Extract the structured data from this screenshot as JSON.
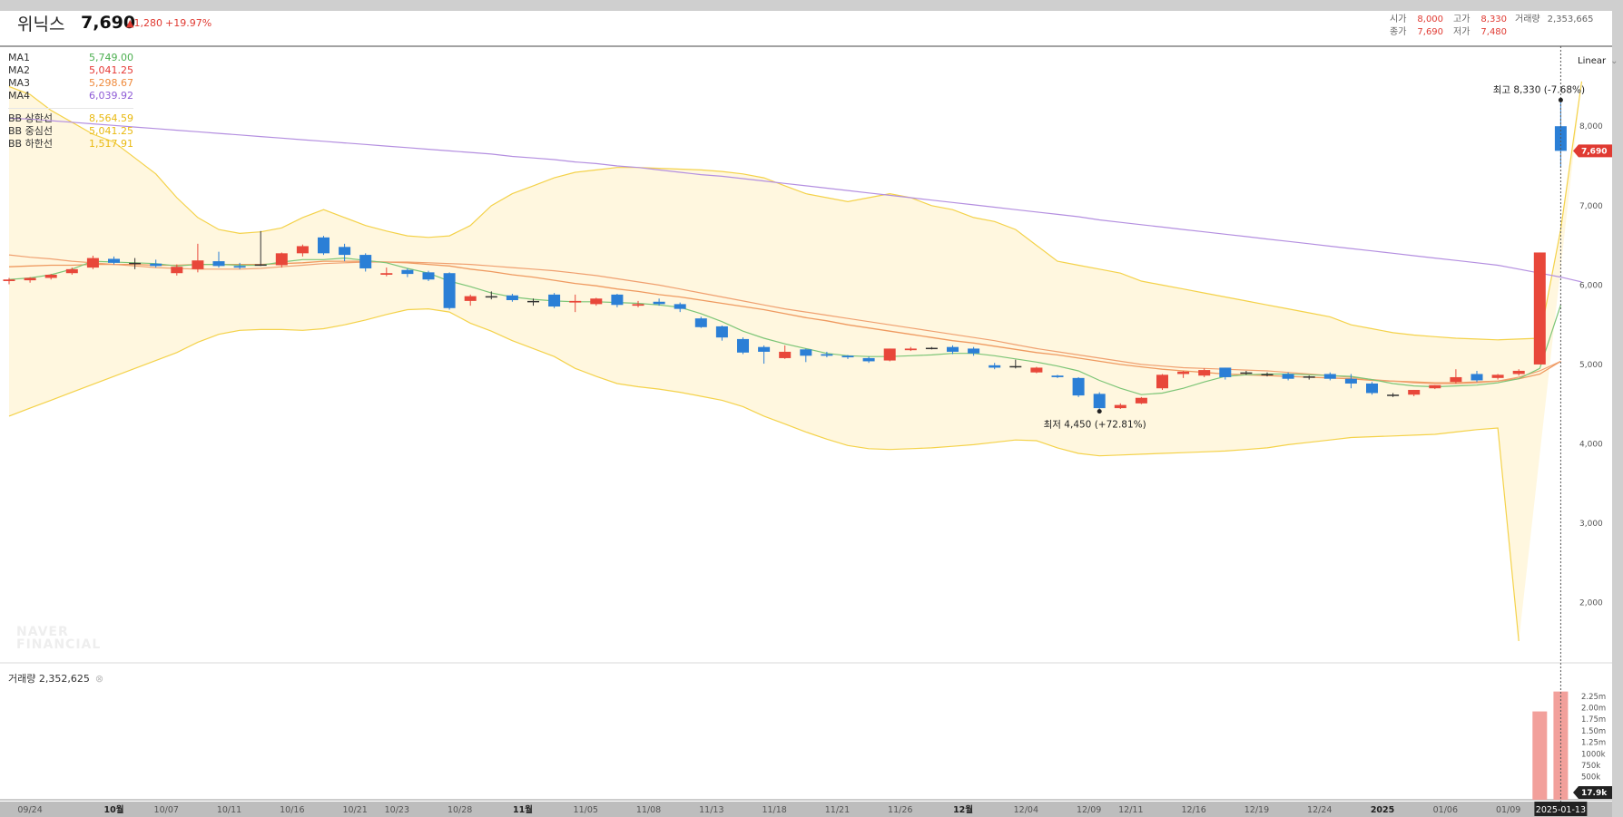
{
  "header": {
    "name": "위닉스",
    "price": "7,690",
    "change": "▲1,280",
    "change_rate": "+19.97%",
    "ohlc": {
      "open_label": "시가",
      "open": "8,000",
      "high_label": "고가",
      "high": "8,330",
      "volume_label": "거래량",
      "volume": "2,353,665",
      "close_label": "종가",
      "close": "7,690",
      "low_label": "저가",
      "low": "7,480"
    }
  },
  "legend": {
    "ma": [
      {
        "name": "MA1",
        "value": "5,749.00",
        "color": "#4caf50"
      },
      {
        "name": "MA2",
        "value": "5,041.25",
        "color": "#e53935"
      },
      {
        "name": "MA3",
        "value": "5,298.67",
        "color": "#ef8a3c"
      },
      {
        "name": "MA4",
        "value": "6,039.92",
        "color": "#8e5bd6"
      }
    ],
    "bb": [
      {
        "name": "BB 상한선",
        "value": "8,564.59",
        "color": "#f2c21b"
      },
      {
        "name": "BB 중심선",
        "value": "5,041.25",
        "color": "#f2c21b"
      },
      {
        "name": "BB 하한선",
        "value": "1,517.91",
        "color": "#f2c21b"
      }
    ]
  },
  "controls": {
    "scale_label": "Linear"
  },
  "watermark": {
    "line1": "NAVER",
    "line2": "FINANCIAL"
  },
  "volume_panel": {
    "label": "거래량 2,352,625",
    "close_icon": "close-icon"
  },
  "annotations": {
    "high": "최고 8,330 (-7.68%)",
    "low": "최저 4,450 (+72.81%)"
  },
  "price_tag": "7,690",
  "volume_tag": "17.9k",
  "crosshair_date": "2025-01-13",
  "colors": {
    "up": "#e8473a",
    "down": "#2b7fd6",
    "band_fill": "#fff7df"
  },
  "chart_data": {
    "type": "candlestick",
    "y_range": [
      1300,
      8950
    ],
    "y_ticks": [
      2000,
      3000,
      4000,
      5000,
      6000,
      7000,
      8000
    ],
    "y_tick_labels": [
      "2,000",
      "3,000",
      "4,000",
      "5,000",
      "6,000",
      "7,000",
      "8,000"
    ],
    "x_ticks": [
      {
        "label": "09/24",
        "i": 1
      },
      {
        "label": "10월",
        "i": 5,
        "bold": true
      },
      {
        "label": "10/07",
        "i": 7.5
      },
      {
        "label": "10/11",
        "i": 10.5
      },
      {
        "label": "10/16",
        "i": 13.5
      },
      {
        "label": "10/21",
        "i": 16.5
      },
      {
        "label": "10/23",
        "i": 18.5
      },
      {
        "label": "10/28",
        "i": 21.5
      },
      {
        "label": "11월",
        "i": 24.5,
        "bold": true
      },
      {
        "label": "11/05",
        "i": 27.5
      },
      {
        "label": "11/08",
        "i": 30.5
      },
      {
        "label": "11/13",
        "i": 33.5
      },
      {
        "label": "11/18",
        "i": 36.5
      },
      {
        "label": "11/21",
        "i": 39.5
      },
      {
        "label": "11/26",
        "i": 42.5
      },
      {
        "label": "12월",
        "i": 45.5,
        "bold": true
      },
      {
        "label": "12/04",
        "i": 48.5
      },
      {
        "label": "12/09",
        "i": 51.5
      },
      {
        "label": "12/11",
        "i": 53.5
      },
      {
        "label": "12/16",
        "i": 56.5
      },
      {
        "label": "12/19",
        "i": 59.5
      },
      {
        "label": "12/24",
        "i": 62.5
      },
      {
        "label": "2025",
        "i": 65.5,
        "bold": true
      },
      {
        "label": "01/06",
        "i": 68.5
      },
      {
        "label": "01/09",
        "i": 71.5
      }
    ],
    "candles": [
      [
        6050,
        6090,
        6010,
        6070
      ],
      [
        6060,
        6100,
        6030,
        6090
      ],
      [
        6090,
        6140,
        6070,
        6130
      ],
      [
        6150,
        6220,
        6130,
        6200
      ],
      [
        6220,
        6370,
        6200,
        6340
      ],
      [
        6330,
        6360,
        6260,
        6280
      ],
      [
        6270,
        6340,
        6200,
        6280
      ],
      [
        6270,
        6320,
        6220,
        6240
      ],
      [
        6150,
        6260,
        6120,
        6230
      ],
      [
        6200,
        6520,
        6160,
        6310
      ],
      [
        6300,
        6420,
        6220,
        6240
      ],
      [
        6240,
        6280,
        6200,
        6220
      ],
      [
        6250,
        6680,
        6240,
        6260
      ],
      [
        6250,
        6410,
        6220,
        6400
      ],
      [
        6400,
        6510,
        6360,
        6490
      ],
      [
        6600,
        6620,
        6380,
        6400
      ],
      [
        6480,
        6520,
        6300,
        6380
      ],
      [
        6380,
        6400,
        6170,
        6210
      ],
      [
        6130,
        6220,
        6110,
        6150
      ],
      [
        6190,
        6210,
        6100,
        6140
      ],
      [
        6160,
        6180,
        6050,
        6070
      ],
      [
        6150,
        6160,
        5690,
        5710
      ],
      [
        5800,
        5880,
        5740,
        5860
      ],
      [
        5860,
        5920,
        5820,
        5860
      ],
      [
        5870,
        5890,
        5790,
        5810
      ],
      [
        5790,
        5830,
        5740,
        5800
      ],
      [
        5880,
        5900,
        5710,
        5730
      ],
      [
        5780,
        5880,
        5660,
        5800
      ],
      [
        5760,
        5840,
        5740,
        5830
      ],
      [
        5880,
        5890,
        5720,
        5750
      ],
      [
        5740,
        5800,
        5720,
        5760
      ],
      [
        5790,
        5830,
        5740,
        5760
      ],
      [
        5760,
        5780,
        5660,
        5700
      ],
      [
        5580,
        5600,
        5460,
        5470
      ],
      [
        5480,
        5490,
        5300,
        5340
      ],
      [
        5320,
        5340,
        5130,
        5150
      ],
      [
        5220,
        5240,
        5010,
        5160
      ],
      [
        5080,
        5240,
        5070,
        5160
      ],
      [
        5190,
        5200,
        5030,
        5110
      ],
      [
        5130,
        5160,
        5090,
        5110
      ],
      [
        5110,
        5120,
        5070,
        5090
      ],
      [
        5080,
        5100,
        5020,
        5040
      ],
      [
        5050,
        5200,
        5040,
        5200
      ],
      [
        5180,
        5220,
        5170,
        5200
      ],
      [
        5210,
        5220,
        5190,
        5200
      ],
      [
        5220,
        5240,
        5130,
        5160
      ],
      [
        5200,
        5220,
        5110,
        5140
      ],
      [
        4990,
        5020,
        4940,
        4960
      ],
      [
        4970,
        5060,
        4950,
        4980
      ],
      [
        4900,
        4970,
        4890,
        4960
      ],
      [
        4860,
        4870,
        4830,
        4840
      ],
      [
        4830,
        4840,
        4590,
        4610
      ],
      [
        4630,
        4650,
        4410,
        4450
      ],
      [
        4450,
        4510,
        4440,
        4490
      ],
      [
        4510,
        4590,
        4500,
        4580
      ],
      [
        4700,
        4880,
        4680,
        4870
      ],
      [
        4880,
        4920,
        4830,
        4910
      ],
      [
        4860,
        4950,
        4840,
        4930
      ],
      [
        4960,
        4960,
        4810,
        4840
      ],
      [
        4900,
        4920,
        4870,
        4890
      ],
      [
        4870,
        4900,
        4850,
        4880
      ],
      [
        4880,
        4900,
        4800,
        4820
      ],
      [
        4840,
        4860,
        4810,
        4850
      ],
      [
        4880,
        4900,
        4800,
        4820
      ],
      [
        4820,
        4880,
        4700,
        4760
      ],
      [
        4760,
        4780,
        4620,
        4640
      ],
      [
        4620,
        4640,
        4590,
        4610
      ],
      [
        4620,
        4680,
        4600,
        4680
      ],
      [
        4700,
        4740,
        4690,
        4740
      ],
      [
        4780,
        4940,
        4760,
        4840
      ],
      [
        4880,
        4920,
        4780,
        4800
      ],
      [
        4830,
        4880,
        4810,
        4870
      ],
      [
        4880,
        4940,
        4860,
        4920
      ],
      [
        5000,
        6410,
        5000,
        6410
      ],
      [
        8000,
        8330,
        7480,
        7690
      ]
    ],
    "ma1": [
      6070,
      6090,
      6130,
      6200,
      6300,
      6290,
      6280,
      6270,
      6240,
      6260,
      6260,
      6250,
      6250,
      6290,
      6320,
      6320,
      6340,
      6310,
      6280,
      6210,
      6150,
      6050,
      5980,
      5900,
      5850,
      5820,
      5800,
      5790,
      5790,
      5780,
      5770,
      5750,
      5720,
      5640,
      5540,
      5420,
      5330,
      5260,
      5200,
      5140,
      5110,
      5100,
      5100,
      5110,
      5120,
      5140,
      5140,
      5110,
      5070,
      5030,
      4980,
      4920,
      4800,
      4700,
      4620,
      4640,
      4700,
      4780,
      4850,
      4870,
      4880,
      4880,
      4870,
      4860,
      4850,
      4810,
      4760,
      4730,
      4720,
      4730,
      4740,
      4770,
      4820,
      4950,
      5749
    ],
    "ma2": [
      null,
      null,
      null,
      null,
      null,
      null,
      null,
      null,
      null,
      null,
      null,
      null,
      null,
      null,
      null,
      null,
      null,
      null,
      null,
      null,
      null,
      null,
      null,
      null,
      null,
      null,
      null,
      null,
      null,
      null,
      null,
      null,
      null,
      null,
      null,
      null,
      null,
      null,
      null,
      null,
      null,
      null,
      null,
      null,
      null,
      null,
      null,
      null,
      null,
      null,
      null,
      null,
      null,
      null,
      null,
      null,
      null,
      null,
      null,
      null,
      null,
      null,
      null,
      null,
      null,
      null,
      null,
      null,
      null,
      null,
      null,
      null,
      null,
      null,
      5041.25
    ],
    "ma3": [
      6380,
      6350,
      6330,
      6300,
      6280,
      6260,
      6240,
      6220,
      6210,
      6200,
      6200,
      6200,
      6210,
      6230,
      6250,
      6270,
      6280,
      6290,
      6290,
      6290,
      6280,
      6270,
      6260,
      6240,
      6220,
      6200,
      6180,
      6150,
      6120,
      6080,
      6040,
      6000,
      5950,
      5900,
      5850,
      5800,
      5750,
      5700,
      5660,
      5620,
      5580,
      5540,
      5500,
      5460,
      5420,
      5380,
      5340,
      5300,
      5250,
      5200,
      5160,
      5120,
      5080,
      5040,
      5000,
      4980,
      4960,
      4950,
      4940,
      4930,
      4920,
      4900,
      4880,
      4860,
      4840,
      4810,
      4790,
      4770,
      4760,
      4760,
      4770,
      4790,
      4840,
      4920,
      5041
    ],
    "ma4": [
      8100,
      8090,
      8070,
      8050,
      8030,
      8010,
      7990,
      7970,
      7950,
      7930,
      7910,
      7890,
      7870,
      7850,
      7830,
      7810,
      7790,
      7770,
      7750,
      7730,
      7710,
      7690,
      7670,
      7650,
      7620,
      7600,
      7580,
      7550,
      7530,
      7500,
      7480,
      7450,
      7420,
      7390,
      7370,
      7340,
      7310,
      7280,
      7250,
      7220,
      7190,
      7160,
      7130,
      7100,
      7070,
      7040,
      7010,
      6980,
      6950,
      6920,
      6890,
      6860,
      6820,
      6790,
      6760,
      6730,
      6700,
      6670,
      6640,
      6610,
      6580,
      6550,
      6520,
      6490,
      6460,
      6430,
      6400,
      6370,
      6340,
      6310,
      6280,
      6250,
      6200,
      6150,
      6100,
      6040
    ],
    "bb_upper": [
      8500,
      8400,
      8200,
      8050,
      7900,
      7800,
      7600,
      7400,
      7100,
      6850,
      6700,
      6650,
      6670,
      6720,
      6850,
      6950,
      6850,
      6750,
      6680,
      6620,
      6600,
      6620,
      6750,
      7000,
      7150,
      7250,
      7350,
      7420,
      7450,
      7480,
      7480,
      7470,
      7460,
      7450,
      7430,
      7400,
      7350,
      7250,
      7150,
      7100,
      7050,
      7100,
      7150,
      7100,
      7000,
      6950,
      6850,
      6800,
      6700,
      6500,
      6300,
      6250,
      6200,
      6150,
      6050,
      6000,
      5950,
      5900,
      5850,
      5800,
      5750,
      5700,
      5650,
      5600,
      5500,
      5450,
      5400,
      5370,
      5350,
      5330,
      5320,
      5310,
      5320,
      5330,
      6700,
      8564
    ],
    "bb_mid": [
      6230,
      6240,
      6250,
      6250,
      6260,
      6260,
      6260,
      6250,
      6250,
      6260,
      6260,
      6260,
      6260,
      6270,
      6280,
      6300,
      6300,
      6300,
      6290,
      6280,
      6260,
      6240,
      6200,
      6170,
      6130,
      6100,
      6060,
      6020,
      5990,
      5950,
      5920,
      5880,
      5850,
      5810,
      5770,
      5730,
      5690,
      5640,
      5590,
      5550,
      5500,
      5460,
      5420,
      5380,
      5340,
      5300,
      5270,
      5230,
      5190,
      5150,
      5120,
      5080,
      5040,
      5000,
      4970,
      4940,
      4920,
      4900,
      4880,
      4870,
      4860,
      4850,
      4840,
      4830,
      4820,
      4800,
      4790,
      4780,
      4770,
      4770,
      4780,
      4790,
      4820,
      4880,
      5041
    ],
    "bb_lower": [
      4350,
      4450,
      4550,
      4650,
      4750,
      4850,
      4950,
      5050,
      5150,
      5280,
      5380,
      5430,
      5440,
      5440,
      5430,
      5450,
      5500,
      5560,
      5630,
      5690,
      5700,
      5660,
      5520,
      5420,
      5300,
      5200,
      5100,
      4950,
      4850,
      4760,
      4720,
      4690,
      4650,
      4600,
      4550,
      4470,
      4350,
      4250,
      4150,
      4060,
      3980,
      3940,
      3930,
      3940,
      3950,
      3970,
      3990,
      4020,
      4050,
      4040,
      3950,
      3880,
      3850,
      3860,
      3870,
      3880,
      3890,
      3900,
      3910,
      3930,
      3950,
      3990,
      4020,
      4050,
      4080,
      4090,
      4100,
      4110,
      4120,
      4150,
      4180,
      4200,
      1517.91
    ],
    "volume_ticks": [
      "2.25m",
      "2.00m",
      "1.75m",
      "1.50m",
      "1.25m",
      "1000k",
      "750k",
      "500k"
    ],
    "volume_ticks_values": [
      2250000,
      2000000,
      1750000,
      1500000,
      1250000,
      1000000,
      750000,
      500000
    ],
    "volume": [
      [
        73,
        1920000
      ],
      [
        74,
        2352625
      ]
    ],
    "volume_max": 2700000
  }
}
